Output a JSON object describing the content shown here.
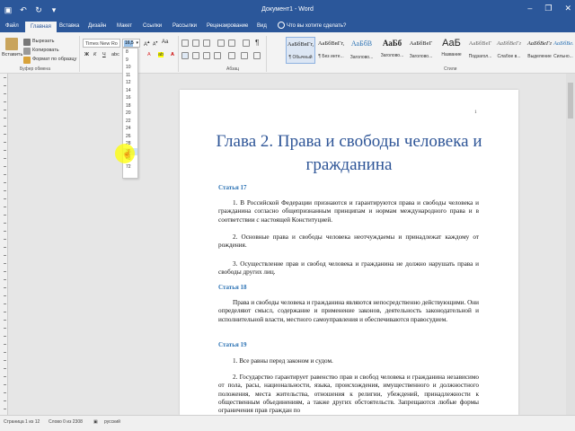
{
  "window": {
    "title": "Документ1 - Word",
    "quick_access": [
      "save-icon",
      "undo-icon",
      "redo-icon",
      "customize-icon"
    ],
    "controls": [
      "minimize-icon",
      "restore-icon",
      "close-icon"
    ]
  },
  "tabs": [
    "Файл",
    "Главная",
    "Вставка",
    "Дизайн",
    "Макет",
    "Ссылки",
    "Рассылки",
    "Рецензирование",
    "Вид"
  ],
  "tell_me": "Что вы хотите сделать?",
  "ribbon": {
    "clipboard": {
      "paste": "Вставить",
      "cut": "Вырезать",
      "copy": "Копировать",
      "format_painter": "Формат по образцу",
      "group": "Буфер обмена"
    },
    "font": {
      "name": "Times New Ro",
      "size": "16,5"
    },
    "paragraph_group": "Абзац",
    "styles_group": "Стили",
    "styles": [
      {
        "sample": "АаБбВвГг,",
        "name": "¶ Обычный",
        "selected": true
      },
      {
        "sample": "АаБбВвГг,",
        "name": "¶ Без инте..."
      },
      {
        "sample": "АаБбВ",
        "name": "Заголово..."
      },
      {
        "sample": "АаБб",
        "name": "Заголово..."
      },
      {
        "sample": "АаБбВеГ",
        "name": "Заголово..."
      },
      {
        "sample": "АаБ",
        "name": "Название"
      },
      {
        "sample": "АаБбВеГ",
        "name": "Подзагол..."
      },
      {
        "sample": "АаБбВеГг",
        "name": "Слабое в..."
      },
      {
        "sample": "АаБбВеГг",
        "name": "Выделение"
      },
      {
        "sample": "АаБбВеГг",
        "name": "Сильно..."
      }
    ]
  },
  "font_size_options": [
    "8",
    "9",
    "10",
    "11",
    "12",
    "14",
    "16",
    "18",
    "20",
    "22",
    "24",
    "26",
    "28",
    "36",
    "48",
    "72"
  ],
  "document": {
    "page_number": "1",
    "heading": "Глава 2. Права и свободы человека и гражданина",
    "blocks": [
      {
        "type": "article",
        "text": "Статья 17"
      },
      {
        "type": "para",
        "text": "1. В Российской Федерации признаются и гарантируются права и свободы человека и гражданина согласно общепризнанным принципам и нормам международного права и в соответствии с настоящей Конституцией."
      },
      {
        "type": "para",
        "text": "2. Основные права и свободы человека неотчуждаемы и принадлежат каждому от рождения."
      },
      {
        "type": "para",
        "text": "3. Осуществление прав и свобод человека и гражданина не должно нарушать права и свободы других лиц."
      },
      {
        "type": "article",
        "text": "Статья 18"
      },
      {
        "type": "para",
        "text": "Права и свободы человека и гражданина являются непосредственно действующими. Они определяют смысл, содержание и применение законов, деятельность законодательной и исполнительной власти, местного самоуправления и обеспечиваются правосудием."
      },
      {
        "type": "article",
        "text": "Статья 19"
      },
      {
        "type": "para",
        "text": "1. Все равны перед законом и судом."
      },
      {
        "type": "para",
        "text": "2. Государство гарантирует равенство прав и свобод человека и гражданина независимо от пола, расы, национальности, языка, происхождения, имущественного и должностного положения, места жительства, отношения к религии, убеждений, принадлежности к общественным объединениям, а также других обстоятельств. Запрещаются любые формы ограничения прав граждан по"
      }
    ]
  },
  "status": {
    "page": "Страница 1 из 12",
    "words": "Слово 0 из 2308",
    "language": "русский"
  }
}
